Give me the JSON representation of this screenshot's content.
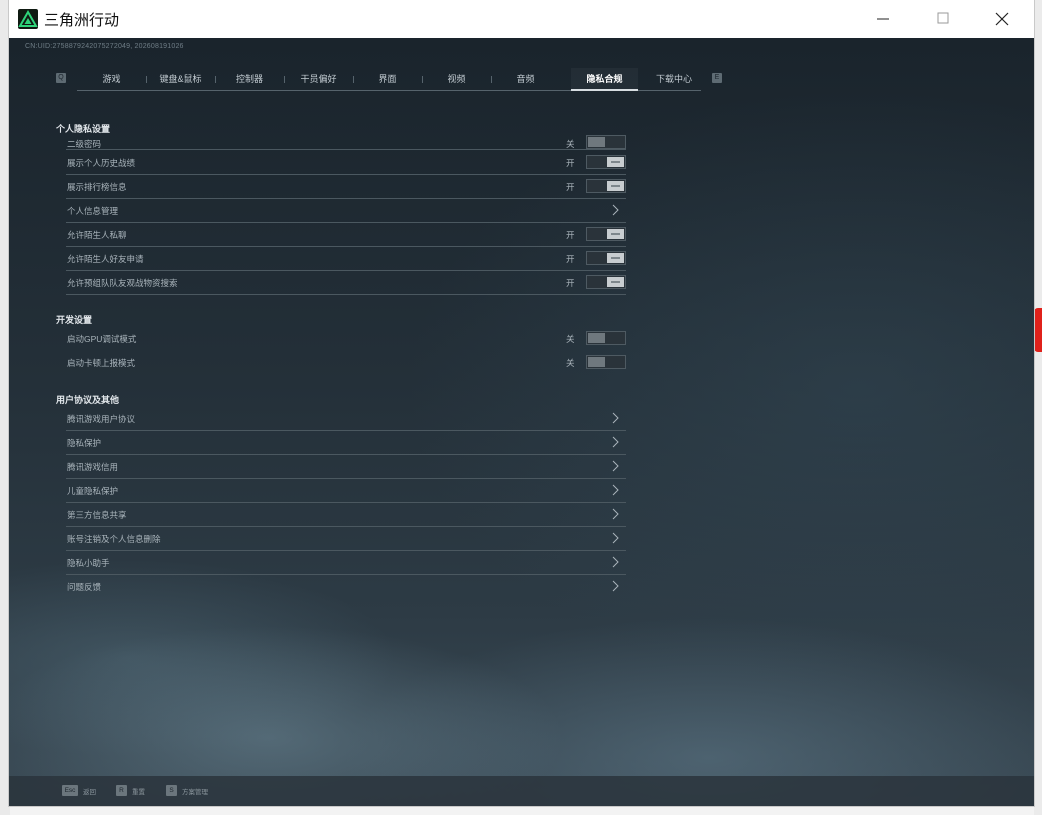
{
  "window": {
    "title": "三角洲行动",
    "minimize_glyph": "—",
    "maximize_glyph": "☐",
    "close_glyph": "✕"
  },
  "uid": "CN:UID:2758879242075272049, 202608191026",
  "nav": {
    "left_key": "Q",
    "right_key": "E",
    "tabs": [
      {
        "label": "游戏"
      },
      {
        "label": "键盘&鼠标"
      },
      {
        "label": "控制器"
      },
      {
        "label": "干员偏好"
      },
      {
        "label": "界面"
      },
      {
        "label": "视频"
      },
      {
        "label": "音频"
      },
      {
        "label": "隐私合规",
        "active": true
      },
      {
        "label": "下载中心"
      }
    ]
  },
  "sections": {
    "privacy": {
      "title": "个人隐私设置",
      "rows": [
        {
          "label": "二级密码",
          "state": "关",
          "type": "toggle",
          "on": false
        },
        {
          "label": "展示个人历史战绩",
          "state": "开",
          "type": "toggle",
          "on": true
        },
        {
          "label": "展示排行榜信息",
          "state": "开",
          "type": "toggle",
          "on": true
        },
        {
          "label": "个人信息管理",
          "type": "link"
        },
        {
          "label": "允许陌生人私聊",
          "state": "开",
          "type": "toggle",
          "on": true
        },
        {
          "label": "允许陌生人好友申请",
          "state": "开",
          "type": "toggle",
          "on": true
        },
        {
          "label": "允许预组队队友观战物资搜索",
          "state": "开",
          "type": "toggle",
          "on": true
        }
      ]
    },
    "dev": {
      "title": "开发设置",
      "rows": [
        {
          "label": "启动GPU调试模式",
          "state": "关",
          "type": "toggle",
          "on": false
        },
        {
          "label": "启动卡顿上报模式",
          "state": "关",
          "type": "toggle",
          "on": false
        }
      ]
    },
    "agreements": {
      "title": "用户协议及其他",
      "rows": [
        {
          "label": "腾讯游戏用户协议",
          "type": "link"
        },
        {
          "label": "隐私保护",
          "type": "link"
        },
        {
          "label": "腾讯游戏信用",
          "type": "link"
        },
        {
          "label": "儿童隐私保护",
          "type": "link"
        },
        {
          "label": "第三方信息共享",
          "type": "link"
        },
        {
          "label": "账号注销及个人信息删除",
          "type": "link"
        },
        {
          "label": "隐私小助手",
          "type": "link"
        },
        {
          "label": "问题反馈",
          "type": "link"
        }
      ]
    }
  },
  "footer": {
    "hints": [
      {
        "key": "Esc",
        "label": "返回"
      },
      {
        "key": "R",
        "label": "重置"
      },
      {
        "key": "S",
        "label": "方案管理"
      }
    ]
  },
  "colors": {
    "accent": "#2fd37a",
    "background": "#1b242c",
    "row_divider": "#4b5860"
  },
  "icons": {
    "app": "delta-force-logo-icon",
    "chevron": "chevron-right-icon"
  }
}
